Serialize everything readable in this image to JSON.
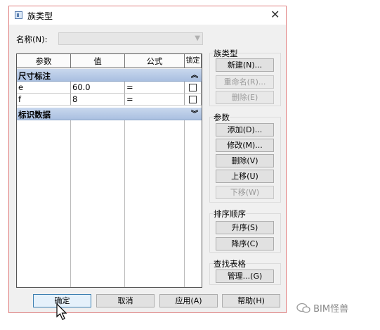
{
  "dialog": {
    "title": "族类型",
    "name_label": "名称(N):",
    "name_value": ""
  },
  "table": {
    "headers": [
      "参数",
      "值",
      "公式",
      "锁定"
    ],
    "groups": [
      {
        "label": "尺寸标注",
        "rows": [
          {
            "param": "e",
            "value": "60.0",
            "formula": "="
          },
          {
            "param": "f",
            "value": "8",
            "formula": "="
          }
        ]
      },
      {
        "label": "标识数据",
        "rows": []
      }
    ]
  },
  "family_types": {
    "title": "族类型",
    "new_label": "新建(N)...",
    "rename_label": "重命名(R)...",
    "delete_label": "删除(E)"
  },
  "parameters": {
    "title": "参数",
    "add_label": "添加(D)...",
    "modify_label": "修改(M)...",
    "delete_label": "删除(V)",
    "up_label": "上移(U)",
    "down_label": "下移(W)"
  },
  "sort": {
    "title": "排序顺序",
    "asc_label": "升序(S)",
    "desc_label": "降序(C)"
  },
  "lookup": {
    "title": "查找表格",
    "manage_label": "管理...(G)"
  },
  "footer": {
    "ok_label": "确定",
    "cancel_label": "取消",
    "apply_label": "应用(A)",
    "help_label": "帮助(H)"
  },
  "watermark": "BIM怪兽"
}
